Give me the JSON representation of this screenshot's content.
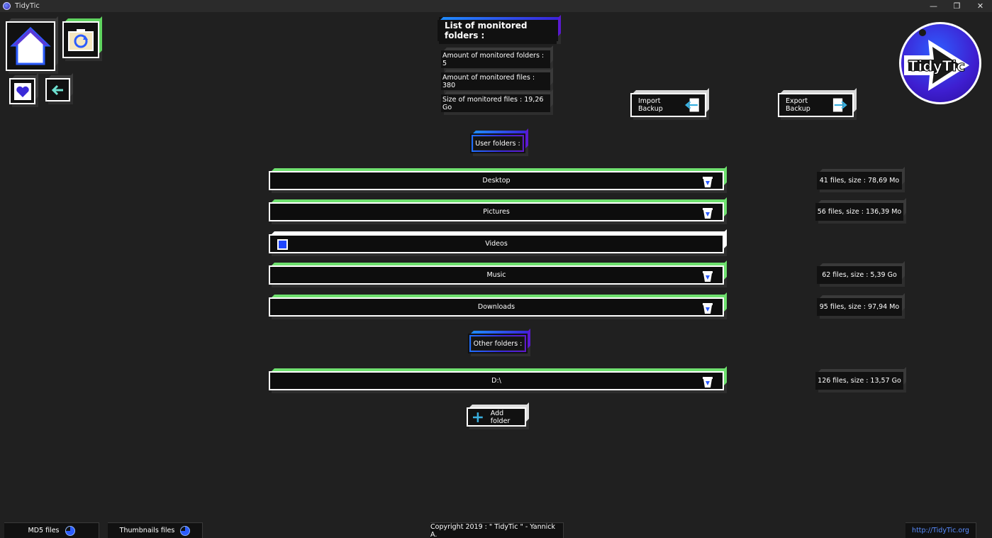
{
  "window": {
    "title": "TidyTic",
    "controls": [
      "—",
      "❐",
      "✕"
    ]
  },
  "nav": {
    "home_icon": "home-icon",
    "duplicates_icon": "refresh-photo-icon",
    "favorites_icon": "heart-icon",
    "back_icon": "arrow-left-icon"
  },
  "header": {
    "title": "List of monitored folders :"
  },
  "stats": {
    "folders": "Amount of monitored folders : 5",
    "files": "Amount of monitored files : 380",
    "size": "Size of monitored files : 19,26 Go"
  },
  "backup": {
    "import_label": "Import Backup",
    "export_label": "Export Backup"
  },
  "logo": {
    "text": "TidyTic"
  },
  "sections": {
    "user_label": "User folders :",
    "other_label": "Other folders :"
  },
  "user_folders": [
    {
      "name": "Desktop",
      "stats": "41 files, size : 78,69 Mo",
      "active": true
    },
    {
      "name": "Pictures",
      "stats": "56 files, size : 136,39 Mo",
      "active": true
    },
    {
      "name": "Videos",
      "stats": "",
      "active": false
    },
    {
      "name": "Music",
      "stats": "62 files, size : 5,39 Go",
      "active": true
    },
    {
      "name": "Downloads",
      "stats": "95 files, size : 97,94 Mo",
      "active": true
    }
  ],
  "other_folders": [
    {
      "name": "D:\\",
      "stats": "126 files, size : 13,57 Go",
      "active": true
    }
  ],
  "add_folder_label": "Add folder",
  "footer": {
    "md5_label": "MD5 files",
    "thumbnails_label": "Thumbnails files",
    "copyright": "Copyright 2019 : \" TidyTic \" - Yannick A.",
    "website": "http://TidyTic.org"
  },
  "colors": {
    "background": "#202020",
    "accent_green": "#6ee06e",
    "accent_blue": "#2b5cff",
    "accent_purple": "#5e18c9",
    "link": "#5a8dff"
  }
}
